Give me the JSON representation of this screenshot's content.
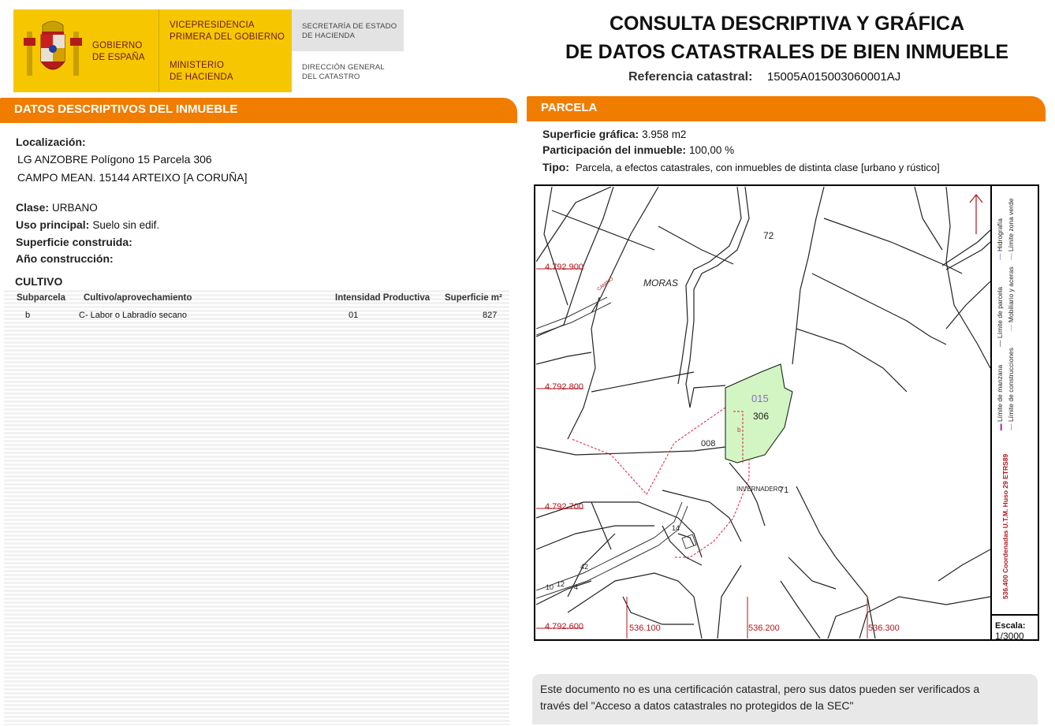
{
  "header": {
    "gov_line1": "GOBIERNO",
    "gov_line2": "DE ESPAÑA",
    "vice_line1": "VICEPRESIDENCIA",
    "vice_line2": "PRIMERA DEL GOBIERNO",
    "min_line1": "MINISTERIO",
    "min_line2": "DE HACIENDA",
    "sec_line1": "SECRETARÍA DE ESTADO",
    "sec_line2": "DE HACIENDA",
    "dir_line1": "DIRECCIÓN GENERAL",
    "dir_line2": "DEL CATASTRO"
  },
  "title": {
    "line1": "CONSULTA DESCRIPTIVA Y GRÁFICA",
    "line2": "DE DATOS CATASTRALES DE BIEN INMUEBLE",
    "ref_label": "Referencia catastral:",
    "ref_value": "15005A015003060001AJ"
  },
  "descriptivos": {
    "heading": "DATOS DESCRIPTIVOS DEL INMUEBLE",
    "localizacion_label": "Localización:",
    "address_line1": "LG ANZOBRE  Polígono 15 Parcela 306",
    "address_line2": "CAMPO MEAN. 15144 ARTEIXO [A CORUÑA]",
    "clase_label": "Clase:",
    "clase_value": "URBANO",
    "uso_label": "Uso principal:",
    "uso_value": "Suelo sin edif.",
    "superficie_label": "Superficie construida:",
    "anio_label": "Año construcción:"
  },
  "cultivo": {
    "heading": "CULTIVO",
    "columns": [
      "Subparcela",
      "Cultivo/aprovechamiento",
      "Intensidad Productiva",
      "Superficie m²"
    ],
    "rows": [
      {
        "subparcela": "b",
        "cultivo": "C- Labor o Labradío secano",
        "intensidad": "01",
        "superficie": "827"
      }
    ]
  },
  "parcela": {
    "heading": "PARCELA",
    "sup_label": "Superficie gráfica:",
    "sup_value": "3.958 m2",
    "part_label": "Participación del inmueble:",
    "part_value": "100,00 %",
    "tipo_label": "Tipo:",
    "tipo_value": "Parcela, a efectos catastrales, con inmuebles de distinta clase [urbano y rústico]"
  },
  "map": {
    "labels": {
      "n4792900": "4.792.900",
      "n4792800": "4.792.800",
      "n4792700": "4.792.700",
      "n4792600": "4.792.600",
      "e536100": "536.100",
      "e536200": "536.200",
      "e536300": "536.300",
      "p72": "72",
      "moras": "MORAS",
      "camino": "CAMINO",
      "p015": "015",
      "p306": "306",
      "sub_b": "b",
      "p008": "008",
      "invernadero": "INVERNADERO",
      "p71": "71",
      "road1": "10",
      "road2": "12",
      "road3": "4",
      "road4": "42",
      "road5": "14"
    },
    "legend": {
      "coords": "536.400 Coordenadas U.T.M. Huso 29 ETRS89",
      "manzana": "Límite de manzana",
      "construcciones": "Límite de construcciones",
      "parcela": "Límite de parcela",
      "mobiliario": "Mobiliario y aceras",
      "hidrografia": "Hidrografía",
      "zona_verde": "Límite zona verde"
    },
    "scale_label": "Escala:",
    "scale_value": "1/3000",
    "colors": {
      "parcel_fill": "#d3f5c4",
      "parcel_stroke": "#7ec86a",
      "subparcel": "#e0203a",
      "coords": "#b0161e",
      "id_015": "#8a6bc8"
    }
  },
  "disclaimer": {
    "line1": "Este documento no es una certificación catastral, pero sus datos pueden ser verificados a",
    "line2": "través del \"Acceso a datos catastrales no protegidos de la SEC\""
  },
  "colors": {
    "accent": "#f07d00",
    "logo_yellow": "#f6c700"
  }
}
